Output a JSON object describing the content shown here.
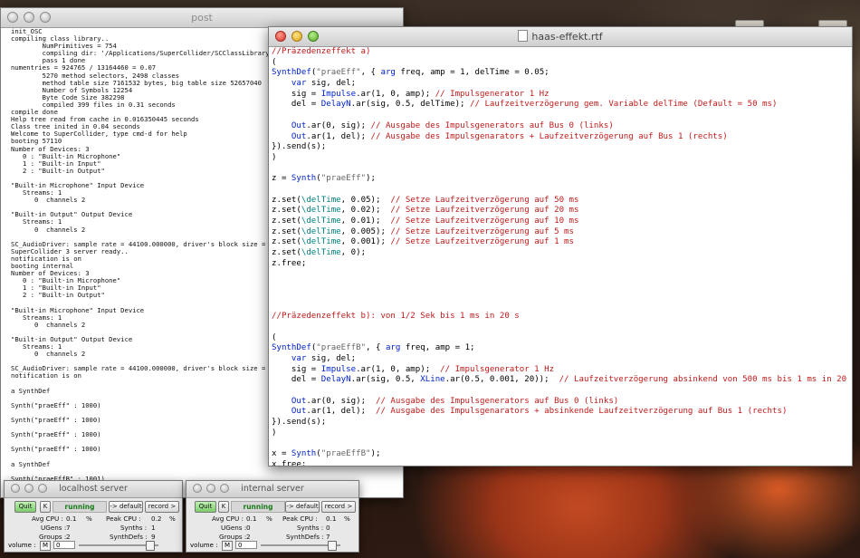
{
  "post_window": {
    "title": "post",
    "lines": [
      "init_OSC",
      "compiling class library..",
      "        NumPrimitives = 754",
      "        compiling dir: '/Applications/SuperCollider/SCClassLibrary'",
      "        pass 1 done",
      "numentries = 924765 / 13164460 = 0.07",
      "        5270 method selectors, 2498 classes",
      "        method table size 7161532 bytes, big table size 52657040",
      "        Number of Symbols 12254",
      "        Byte Code Size 382298",
      "        compiled 399 files in 0.31 seconds",
      "compile done",
      "Help tree read from cache in 0.016350445 seconds",
      "Class tree inited in 0.04 seconds",
      "Welcome to SuperCollider, type cmd-d for help",
      "booting 57110",
      "Number of Devices: 3",
      "   0 : \"Built-in Microphone\"",
      "   1 : \"Built-in Input\"",
      "   2 : \"Built-in Output\"",
      "",
      "\"Built-in Microphone\" Input Device",
      "   Streams: 1",
      "      0  channels 2",
      "",
      "\"Built-in Output\" Output Device",
      "   Streams: 1",
      "      0  channels 2",
      "",
      "SC_AudioDriver: sample rate = 44100.000000, driver's block size = 512",
      "SuperCollider 3 server ready..",
      "notification is on",
      "booting internal",
      "Number of Devices: 3",
      "   0 : \"Built-in Microphone\"",
      "   1 : \"Built-in Input\"",
      "   2 : \"Built-in Output\"",
      "",
      "\"Built-in Microphone\" Input Device",
      "   Streams: 1",
      "      0  channels 2",
      "",
      "\"Built-in Output\" Output Device",
      "   Streams: 1",
      "      0  channels 2",
      "",
      "SC_AudioDriver: sample rate = 44100.000000, driver's block size = 512",
      "notification is on",
      "",
      "a SynthDef",
      "",
      "Synth(\"praeEff\" : 1000)",
      "",
      "Synth(\"praeEff\" : 1000)",
      "",
      "Synth(\"praeEff\" : 1000)",
      "",
      "Synth(\"praeEff\" : 1000)",
      "",
      "a SynthDef",
      "",
      "Synth(\"praeEffB\" : 1001)"
    ]
  },
  "editor_window": {
    "title": "haas-effekt.rtf",
    "code": [
      [
        {
          "t": "//Präzedenzeffekt a)",
          "c": "c"
        }
      ],
      [
        {
          "t": "("
        }
      ],
      [
        {
          "t": "SynthDef",
          "c": "k"
        },
        {
          "t": "("
        },
        {
          "t": "\"praeEff\"",
          "c": "s"
        },
        {
          "t": ", { "
        },
        {
          "t": "arg",
          "c": "k"
        },
        {
          "t": " freq, amp = 1, delTime = 0.05;"
        }
      ],
      [
        {
          "t": "    "
        },
        {
          "t": "var",
          "c": "k"
        },
        {
          "t": " sig, del;"
        }
      ],
      [
        {
          "t": "    sig = "
        },
        {
          "t": "Impulse",
          "c": "k"
        },
        {
          "t": ".ar(1, 0, amp); "
        },
        {
          "t": "// Impulsgenerator 1 Hz",
          "c": "c"
        }
      ],
      [
        {
          "t": "    del = "
        },
        {
          "t": "DelayN",
          "c": "k"
        },
        {
          "t": ".ar(sig, 0.5, delTime); "
        },
        {
          "t": "// Laufzeitverzögerung gem. Variable delTime (Default = 50 ms)",
          "c": "c"
        }
      ],
      [
        {
          "t": ""
        }
      ],
      [
        {
          "t": "    "
        },
        {
          "t": "Out",
          "c": "k"
        },
        {
          "t": ".ar(0, sig); "
        },
        {
          "t": "// Ausgabe des Impulsgenerators auf Bus 0 (links)",
          "c": "c"
        }
      ],
      [
        {
          "t": "    "
        },
        {
          "t": "Out",
          "c": "k"
        },
        {
          "t": ".ar(1, del); "
        },
        {
          "t": "// Ausgabe des Impulsgenarators + Laufzeitverzögerung auf Bus 1 (rechts)",
          "c": "c"
        }
      ],
      [
        {
          "t": "}).send(s);"
        }
      ],
      [
        {
          "t": ")"
        }
      ],
      [
        {
          "t": ""
        }
      ],
      [
        {
          "t": "z = "
        },
        {
          "t": "Synth",
          "c": "k"
        },
        {
          "t": "("
        },
        {
          "t": "\"praeEff\"",
          "c": "s"
        },
        {
          "t": ");"
        }
      ],
      [
        {
          "t": ""
        }
      ],
      [
        {
          "t": "z.set("
        },
        {
          "t": "\\delTime",
          "c": "sym"
        },
        {
          "t": ", 0.05);  "
        },
        {
          "t": "// Setze Laufzeitverzögerung auf 50 ms",
          "c": "c"
        }
      ],
      [
        {
          "t": "z.set("
        },
        {
          "t": "\\delTime",
          "c": "sym"
        },
        {
          "t": ", 0.02);  "
        },
        {
          "t": "// Setze Laufzeitverzögerung auf 20 ms",
          "c": "c"
        }
      ],
      [
        {
          "t": "z.set("
        },
        {
          "t": "\\delTime",
          "c": "sym"
        },
        {
          "t": ", 0.01);  "
        },
        {
          "t": "// Setze Laufzeitverzögerung auf 10 ms",
          "c": "c"
        }
      ],
      [
        {
          "t": "z.set("
        },
        {
          "t": "\\delTime",
          "c": "sym"
        },
        {
          "t": ", 0.005); "
        },
        {
          "t": "// Setze Laufzeitverzögerung auf 5 ms",
          "c": "c"
        }
      ],
      [
        {
          "t": "z.set("
        },
        {
          "t": "\\delTime",
          "c": "sym"
        },
        {
          "t": ", 0.001); "
        },
        {
          "t": "// Setze Laufzeitverzögerung auf 1 ms",
          "c": "c"
        }
      ],
      [
        {
          "t": "z.set("
        },
        {
          "t": "\\delTime",
          "c": "sym"
        },
        {
          "t": ", 0);"
        }
      ],
      [
        {
          "t": "z.free;"
        }
      ],
      [
        {
          "t": ""
        }
      ],
      [
        {
          "t": ""
        }
      ],
      [
        {
          "t": ""
        }
      ],
      [
        {
          "t": ""
        }
      ],
      [
        {
          "t": "//Präzedenzeffekt b): von 1/2 Sek bis 1 ms in 20 s",
          "c": "c"
        }
      ],
      [
        {
          "t": ""
        }
      ],
      [
        {
          "t": "("
        }
      ],
      [
        {
          "t": "SynthDef",
          "c": "k"
        },
        {
          "t": "("
        },
        {
          "t": "\"praeEffB\"",
          "c": "s"
        },
        {
          "t": ", { "
        },
        {
          "t": "arg",
          "c": "k"
        },
        {
          "t": " freq, amp = 1;"
        }
      ],
      [
        {
          "t": "    "
        },
        {
          "t": "var",
          "c": "k"
        },
        {
          "t": " sig, del;"
        }
      ],
      [
        {
          "t": "    sig = "
        },
        {
          "t": "Impulse",
          "c": "k"
        },
        {
          "t": ".ar(1, 0, amp);  "
        },
        {
          "t": "// Impulsgenerator 1 Hz",
          "c": "c"
        }
      ],
      [
        {
          "t": "    del = "
        },
        {
          "t": "DelayN",
          "c": "k"
        },
        {
          "t": ".ar(sig, 0.5, "
        },
        {
          "t": "XLine",
          "c": "k"
        },
        {
          "t": ".ar(0.5, 0.001, 20));  "
        },
        {
          "t": "// Laufzeitverzögerung absinkend von 500 ms bis 1 ms in 20 s",
          "c": "c"
        }
      ],
      [
        {
          "t": ""
        }
      ],
      [
        {
          "t": "    "
        },
        {
          "t": "Out",
          "c": "k"
        },
        {
          "t": ".ar(0, sig);  "
        },
        {
          "t": "// Ausgabe des Impulsgenerators auf Bus 0 (links)",
          "c": "c"
        }
      ],
      [
        {
          "t": "    "
        },
        {
          "t": "Out",
          "c": "k"
        },
        {
          "t": ".ar(1, del);  "
        },
        {
          "t": "// Ausgabe des Impulsgenarators + absinkende Laufzeitverzögerung auf Bus 1 (rechts)",
          "c": "c"
        }
      ],
      [
        {
          "t": "}).send(s);"
        }
      ],
      [
        {
          "t": ")"
        }
      ],
      [
        {
          "t": ""
        }
      ],
      [
        {
          "t": "x = "
        },
        {
          "t": "Synth",
          "c": "k"
        },
        {
          "t": "("
        },
        {
          "t": "\"praeEffB\"",
          "c": "s"
        },
        {
          "t": ");"
        }
      ],
      [
        {
          "t": "x.free;"
        }
      ]
    ]
  },
  "servers": [
    {
      "id": "local",
      "title": "localhost server",
      "quit": "Quit",
      "k": "K",
      "status": "running",
      "default": "-> default",
      "record": "record >",
      "avg_cpu_label": "Avg CPU :",
      "avg_cpu": "0.1",
      "pct1": "%",
      "peak_cpu_label": "Peak CPU :",
      "peak_cpu": "0.2",
      "pct2": "%",
      "ugens_label": "UGens :",
      "ugens": "7",
      "synths_label": "Synths :",
      "synths": "1",
      "groups_label": "Groups :",
      "groups": "2",
      "synthdefs_label": "SynthDefs :",
      "synthdefs": "9",
      "volume_label": "volume :",
      "mute": "M",
      "volume": "0"
    },
    {
      "id": "internal",
      "title": "internal server",
      "quit": "Quit",
      "k": "K",
      "status": "running",
      "default": "-> default",
      "record": "record >",
      "avg_cpu_label": "Avg CPU :",
      "avg_cpu": "0.1",
      "pct1": "%",
      "peak_cpu_label": "Peak CPU :",
      "peak_cpu": "0.1",
      "pct2": "%",
      "ugens_label": "UGens :",
      "ugens": "0",
      "synths_label": "Synths :",
      "synths": "0",
      "groups_label": "Groups :",
      "groups": "2",
      "synthdefs_label": "SynthDefs :",
      "synthdefs": "7",
      "volume_label": "volume :",
      "mute": "M",
      "volume": "0"
    }
  ],
  "colors": {
    "comment": "#c01a1a",
    "keyword": "#0022cc",
    "string": "#666666",
    "symbol": "#008080",
    "running_text": "#1a7a1a",
    "quit_button": "#7dcc6d"
  }
}
